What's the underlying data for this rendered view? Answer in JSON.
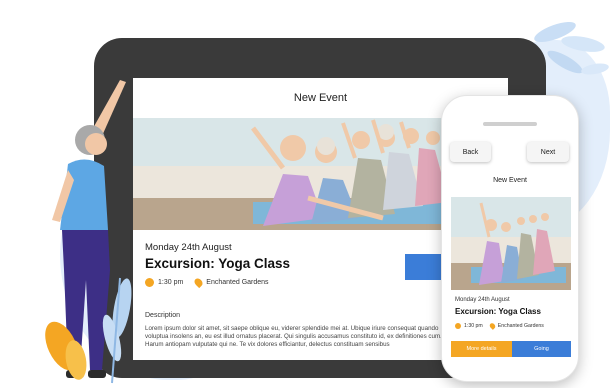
{
  "colors": {
    "accent_orange": "#f4a623",
    "accent_blue": "#3b7dd8",
    "device_frame": "#3a3a3a",
    "decor_blue": "#dbe9f8"
  },
  "tablet": {
    "title": "New Event",
    "date": "Monday 24th August",
    "event_name": "Excursion: Yoga Class",
    "time": "1:30 pm",
    "location": "Enchanted Gardens",
    "description_heading": "Description",
    "description": "Lorem ipsum dolor sit amet, sit saepe oblique eu, viderer splendide mei at. Ubique iriure consequat quando voluptua insolens an, eu est illud ornatus placerat. Qui singulis accusamus constituto id, ex definitiones cum. Harum antiopam vulputate qui ne. Te vix dolores efficiantur, delectus constituam sensibus"
  },
  "phone": {
    "back_label": "Back",
    "next_label": "Next",
    "title": "New Event",
    "date": "Monday 24th August",
    "event_name": "Excursion: Yoga Class",
    "time": "1:30 pm",
    "location": "Enchanted Gardens",
    "more_details_label": "More details",
    "going_label": "Going"
  },
  "icons": {
    "time": "clock-icon",
    "location": "location-pin-icon"
  }
}
